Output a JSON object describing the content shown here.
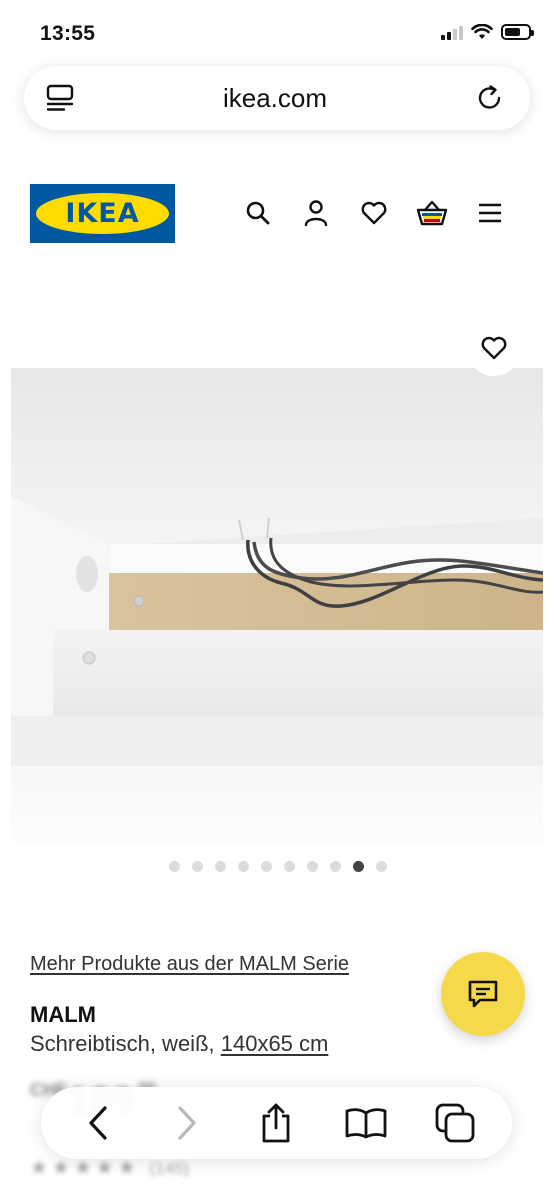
{
  "status_bar": {
    "time": "13:55"
  },
  "browser": {
    "url": "ikea.com"
  },
  "header": {
    "logo_text": "IKEA",
    "icons": [
      "search-icon",
      "account-icon",
      "heart-icon",
      "basket-icon",
      "menu-icon"
    ]
  },
  "gallery": {
    "image_count": 10,
    "active_index": 8
  },
  "product": {
    "series_link": "Mehr Produkte aus der MALM Serie",
    "name": "MALM",
    "description": "Schreibtisch, weiß, ",
    "size": "140x65 cm",
    "price_currency": "CHF",
    "price_integer": "189",
    "price_cents": ".00",
    "rating_count": "(145)"
  },
  "colors": {
    "brand_blue": "#0058a3",
    "brand_yellow": "#ffdb00",
    "chat_fab": "#f5d94a"
  }
}
